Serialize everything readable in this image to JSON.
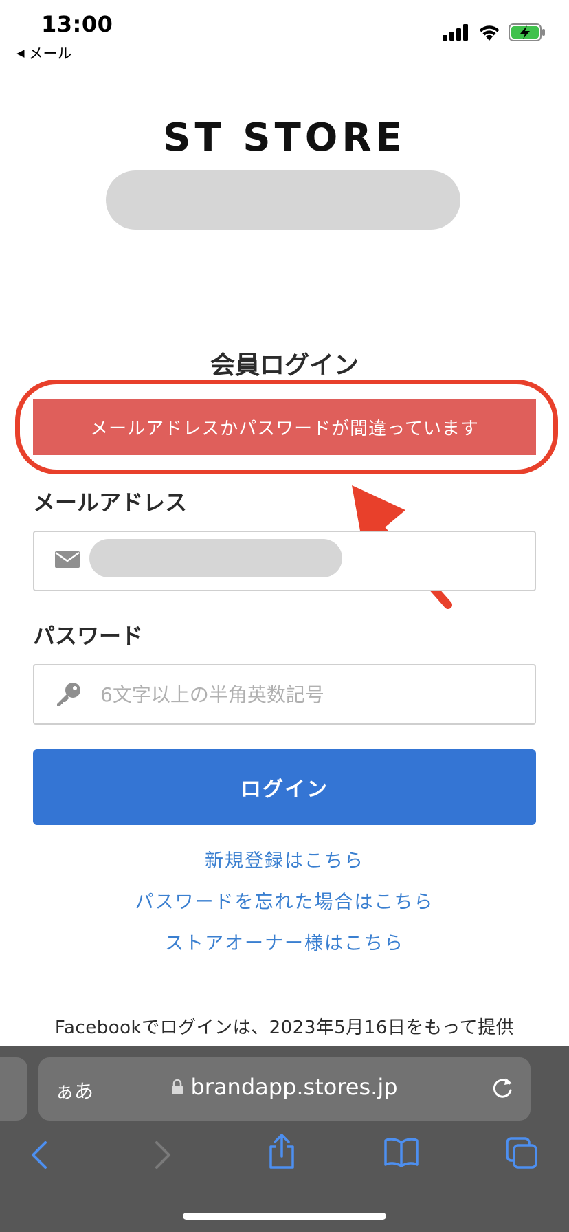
{
  "status_bar": {
    "time": "13:00",
    "back_label": "メール",
    "icons": [
      "cellular-signal-icon",
      "wifi-icon",
      "battery-charging-icon"
    ]
  },
  "header": {
    "store_name": "ST STORE"
  },
  "login": {
    "title": "会員ログイン",
    "error_message": "メールアドレスかパスワードが間違っています",
    "email_label": "メールアドレス",
    "password_label": "パスワード",
    "password_placeholder": "6文字以上の半角英数記号",
    "submit_label": "ログイン"
  },
  "links": {
    "signup": "新規登録はこちら",
    "forgot_password": "パスワードを忘れた場合はこちら",
    "store_owner": "ストアオーナー様はこちら"
  },
  "notice": "Facebookでログインは、2023年5月16日をもって提供",
  "browser": {
    "aa_label": "ぁあ",
    "url": "brandapp.stores.jp"
  },
  "colors": {
    "error": "#df5f5b",
    "primary": "#3475d4",
    "link": "#3a7fd0",
    "annotation": "#e8402b",
    "safari_chrome": "#575757",
    "safari_icons": "#4d8ff0"
  }
}
